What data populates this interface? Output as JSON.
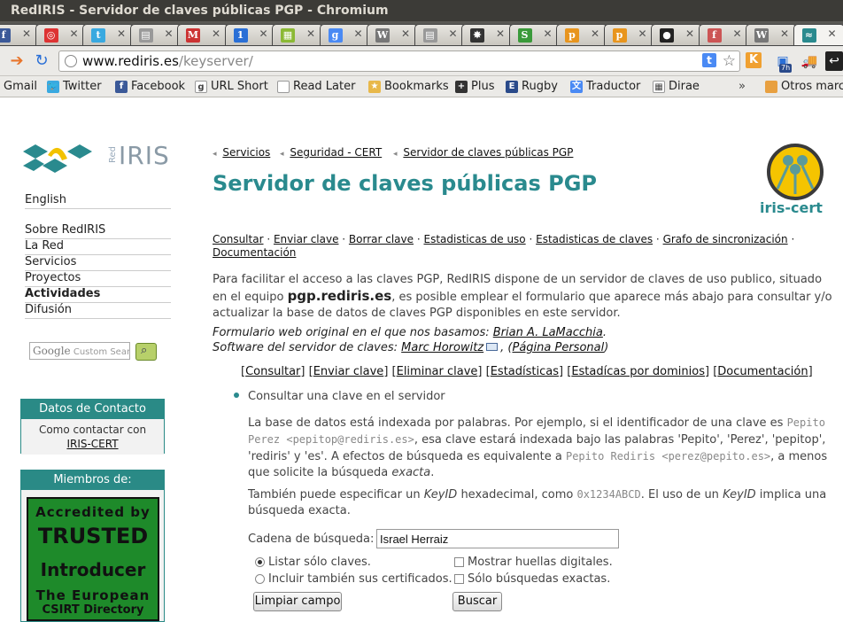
{
  "window": {
    "title": "RedIRIS - Servidor de claves públicas PGP - Chromium"
  },
  "tabs": [
    {
      "icon": "facebook-icon",
      "glyph": "f",
      "color": "#3b5998"
    },
    {
      "icon": "target-icon",
      "glyph": "◎",
      "color": "#d33"
    },
    {
      "icon": "twitter-icon",
      "glyph": "t",
      "color": "#39a9e0"
    },
    {
      "icon": "document-icon",
      "glyph": "▤",
      "color": "#999"
    },
    {
      "icon": "gmail-icon",
      "glyph": "M",
      "color": "#c33"
    },
    {
      "icon": "calendar-icon",
      "glyph": "1",
      "color": "#2a6fd6"
    },
    {
      "icon": "app-icon",
      "glyph": "▦",
      "color": "#8bb935"
    },
    {
      "icon": "google-icon",
      "glyph": "g",
      "color": "#4a8af4"
    },
    {
      "icon": "wikipedia-icon",
      "glyph": "W",
      "color": "#777"
    },
    {
      "icon": "document-icon",
      "glyph": "▤",
      "color": "#999"
    },
    {
      "icon": "rugby-icon",
      "glyph": "✸",
      "color": "#333"
    },
    {
      "icon": "s-icon",
      "glyph": "S",
      "color": "#3a9a3a"
    },
    {
      "icon": "p-icon",
      "glyph": "p",
      "color": "#e8951e"
    },
    {
      "icon": "p-icon",
      "glyph": "p",
      "color": "#e8951e"
    },
    {
      "icon": "circle-icon",
      "glyph": "●",
      "color": "#222"
    },
    {
      "icon": "f-icon",
      "glyph": "f",
      "color": "#c55"
    },
    {
      "icon": "wikipedia-icon",
      "glyph": "W",
      "color": "#777"
    },
    {
      "icon": "rediris-icon",
      "glyph": "≈",
      "color": "#2a8a8e"
    }
  ],
  "toolbar": {
    "url_host": "www.rediris.es",
    "url_path": "/keyserver/",
    "ext_t": "t",
    "ext_k": "K",
    "ext_badge": "7h"
  },
  "bookmarks": [
    {
      "label": "Gmail",
      "icon": "gmail-icon",
      "color": "transparent",
      "glyph": ""
    },
    {
      "label": "Twitter",
      "icon": "twitter-bird-icon",
      "color": "#39a9e0",
      "glyph": "🐦"
    },
    {
      "label": "Facebook",
      "icon": "facebook-icon",
      "color": "#3b5998",
      "glyph": "f"
    },
    {
      "label": "URL Short",
      "icon": "google-icon",
      "color": "#fff",
      "glyph": "g"
    },
    {
      "label": "Read Later",
      "icon": "page-icon",
      "color": "#fff",
      "glyph": ""
    },
    {
      "label": "Bookmarks",
      "icon": "bookmark-star-icon",
      "color": "#e8b84a",
      "glyph": "★"
    },
    {
      "label": "Plus",
      "icon": "plus-icon",
      "color": "#333",
      "glyph": "+"
    },
    {
      "label": "Rugby",
      "icon": "e-icon",
      "color": "#2a4a8a",
      "glyph": "E"
    },
    {
      "label": "Traductor",
      "icon": "translate-icon",
      "color": "#4a8af4",
      "glyph": "文"
    },
    {
      "label": "Dirae",
      "icon": "grid-icon",
      "color": "#fff",
      "glyph": "▦"
    }
  ],
  "bookmarks_more": "»",
  "bookmarks_other": "Otros marc",
  "sidebar": {
    "brand": "IRIS",
    "brand_small": "Red",
    "lang": "English",
    "items": [
      {
        "label": "Sobre RedIRIS",
        "bold": false
      },
      {
        "label": "La Red",
        "bold": false
      },
      {
        "label": "Servicios",
        "bold": false
      },
      {
        "label": "Proyectos",
        "bold": false
      },
      {
        "label": "Actividades",
        "bold": true
      },
      {
        "label": "Difusión",
        "bold": false
      }
    ],
    "search_google": "Google",
    "search_placeholder": "Custom Search",
    "contact_title": "Datos de Contacto",
    "contact_text": "Como contactar con",
    "contact_link": "IRIS-CERT",
    "members_title": "Miembros de:",
    "trusted_lines": [
      "Accredited by",
      "TRUSTED",
      "Introducer",
      "The European",
      "CSIRT Directory"
    ]
  },
  "breadcrumb": [
    "Servicios",
    "Seguridad - CERT",
    "Servidor de claves públicas PGP"
  ],
  "page_title": "Servidor de claves públicas PGP",
  "iris_cert_label": "iris-cert",
  "nav_links": [
    "Consultar",
    "Enviar clave",
    "Borrar clave",
    "Estadisticas de uso",
    "Estadisticas de claves",
    "Grafo de sincronización",
    "Documentación"
  ],
  "intro": {
    "part1": "Para facilitar el acceso a las claves PGP, RedIRIS dispone de un servidor de claves de uso publico, situado en el equipo ",
    "host": "pgp.rediris.es",
    "part2": ", es posible emplear el formulario que aparece más abajo para consultar y/o actualizar la base de datos de claves PGP disponibles en este servidor."
  },
  "credits": {
    "line1_text": "Formulario web original en el que nos basamos: ",
    "line1_link": "Brian A. LaMacchia",
    "line2_text": "Software del servidor de claves: ",
    "line2_link": "Marc Horowitz",
    "line2_link2": "Página Personal"
  },
  "sub_tabs": [
    "Consultar",
    "Enviar clave",
    "Eliminar clave",
    "Estadísticas",
    "Estadícas por dominios",
    "Documentación"
  ],
  "section_title": "Consultar una clave en el servidor",
  "para1": {
    "a": "La base de datos está indexada por palabras. Por ejemplo, si el identificador de una clave es ",
    "m1": "Pepito Perez <pepitop@rediris.es>",
    "b": ", esa clave estará indexada bajo las palabras 'Pepito', 'Perez', 'pepitop', 'rediris' y 'es'. A efectos de búsqueda es equivalente a ",
    "m2": "Pepito Rediris <perez@pepito.es>",
    "c": ", a menos que solicite la búsqueda ",
    "em": "exacta",
    "d": "."
  },
  "para2": {
    "a": "También puede especificar un ",
    "k1": "KeyID",
    "b": " hexadecimal, como ",
    "m": "0x1234ABCD",
    "c": ". El uso de un ",
    "k2": "KeyID",
    "d": " implica una búsqueda exacta."
  },
  "form": {
    "label": "Cadena de búsqueda:",
    "value": "Israel Herraiz",
    "radio1": "Listar sólo claves.",
    "radio2": "Incluir también sus certificados.",
    "check1": "Mostrar huellas digitales.",
    "check2": "Sólo búsquedas exactas.",
    "clear_button": "Limpiar campo",
    "search_button": "Buscar"
  }
}
